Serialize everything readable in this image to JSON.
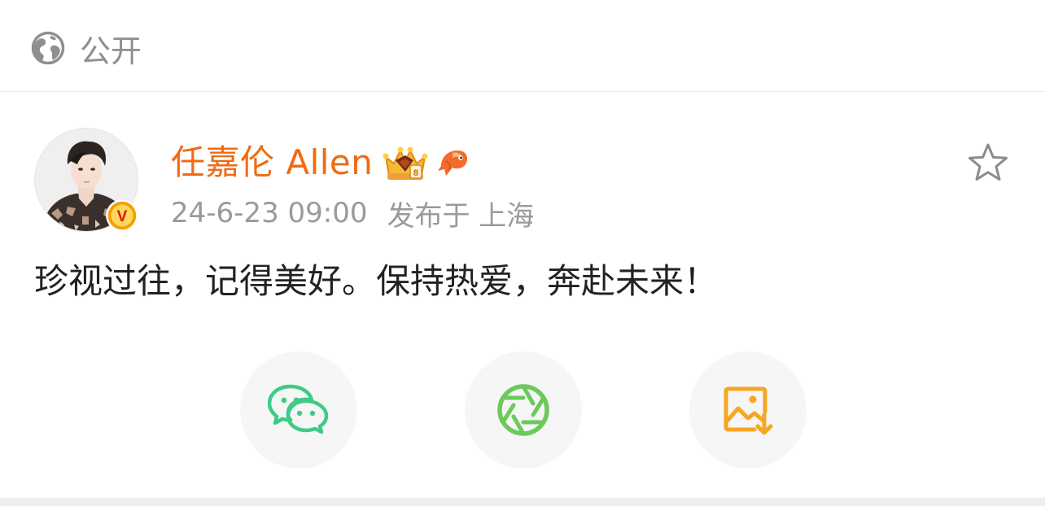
{
  "visibility": {
    "icon": "globe-icon",
    "label": "公开"
  },
  "post": {
    "author": {
      "name": "任嘉伦 Allen",
      "verified_badge_letter": "V",
      "badges": [
        "crown-vip-icon",
        "fish-icon"
      ]
    },
    "timestamp": "24-6-23 09:00",
    "source": "发布于 上海",
    "text": "珍视过往，记得美好。保持热爱，奔赴未来！",
    "favorite_icon": "star-outline-icon"
  },
  "share": {
    "buttons": [
      {
        "name": "wechat",
        "icon": "wechat-icon"
      },
      {
        "name": "moments",
        "icon": "aperture-icon"
      },
      {
        "name": "save-image",
        "icon": "image-download-icon"
      }
    ]
  },
  "colors": {
    "author_name": "#f06b12",
    "meta_text": "#9a9a9a",
    "body_text": "#222222",
    "wechat_green": "#3ecb86",
    "moments_green": "#6cc95a",
    "save_orange": "#f5a623",
    "verified_bg": "#f3a008",
    "verified_letter": "#d6161d"
  }
}
